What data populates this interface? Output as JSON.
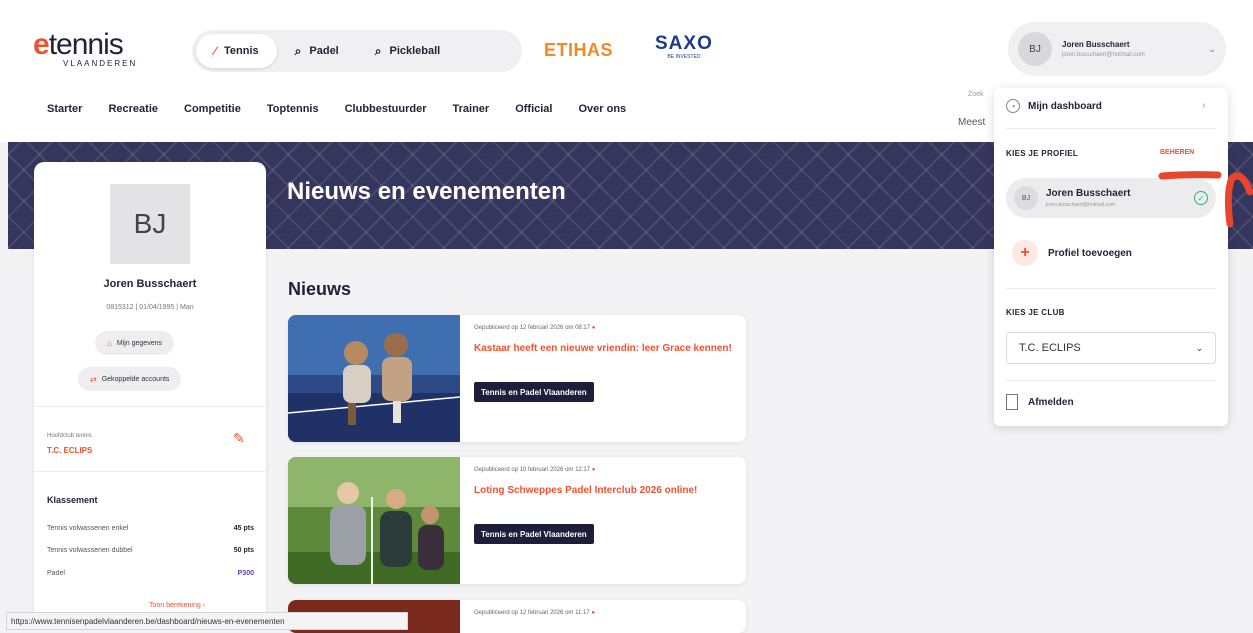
{
  "brand": {
    "logo_word": "tennis",
    "logo_sub": "VLAANDEREN"
  },
  "sports": [
    {
      "label": "Tennis",
      "icon": "tennis-racket-icon"
    },
    {
      "label": "Padel",
      "icon": "padel-racket-icon"
    },
    {
      "label": "Pickleball",
      "icon": "pickleball-paddle-icon"
    }
  ],
  "sponsors": {
    "etihas": "ETIHAS",
    "saxo": "SAXO",
    "saxo_sub": "BE INVESTED"
  },
  "nav": [
    "Starter",
    "Recreatie",
    "Competitie",
    "Toptennis",
    "Clubbestuurder",
    "Trainer",
    "Official",
    "Over ons"
  ],
  "search_fragment": "Meest",
  "search_hint": "Zoek",
  "user": {
    "initials": "BJ",
    "name": "Joren Busschaert",
    "email": "joren.busschaert@hotmail.com"
  },
  "hero": {
    "title": "Nieuws en evenementen"
  },
  "profile": {
    "initials": "BJ",
    "name": "Joren Busschaert",
    "meta": "0815312 | 01/04/1995 | Man",
    "btn_data": "Mijn gegevens",
    "btn_accounts": "Gekoppelde accounts",
    "club_label": "Hoofdclub tennis",
    "club_value": "T.C. ECLIPS",
    "ranking_title": "Klassement",
    "rows": [
      {
        "label": "Tennis volwassenen enkel",
        "value": "45 pts"
      },
      {
        "label": "Tennis volwassenen dubbel",
        "value": "50 pts"
      },
      {
        "label": "Padel",
        "value": "P300"
      }
    ],
    "link": "Toon berekening"
  },
  "news": {
    "title": "Nieuws",
    "items": [
      {
        "date": "Gepubliceerd op 12 februari 2026 om 08:17",
        "headline": "Kastaar heeft een nieuwe vriendin: leer Grace kennen!",
        "tag": "Tennis en Padel Vlaanderen"
      },
      {
        "date": "Gepubliceerd op 10 februari 2026 om 12:17",
        "headline": "Loting Schweppes Padel Interclub 2026 online!",
        "tag": "Tennis en Padel Vlaanderen"
      },
      {
        "date": "Gepubliceerd op 12 februari 2026 om 11:17",
        "headline": "",
        "tag": ""
      }
    ]
  },
  "dropdown": {
    "dashboard": "Mijn dashboard",
    "profile_label": "KIES JE PROFIEL",
    "manage": "BEHEREN",
    "profile_name": "Joren Busschaert",
    "profile_email": "joren.busschaert@hotmail.com",
    "profile_initials": "BJ",
    "add_profile": "Profiel toevoegen",
    "club_label": "KIES JE CLUB",
    "club_selected": "T.C. ECLIPS",
    "logout": "Afmelden"
  },
  "status_url": "https://www.tennisenpadelvlaanderen.be/dashboard/nieuws-en-evenementen",
  "colors": {
    "accent": "#ef5230",
    "navy": "#1e1e3a",
    "hero": "#35365e"
  }
}
